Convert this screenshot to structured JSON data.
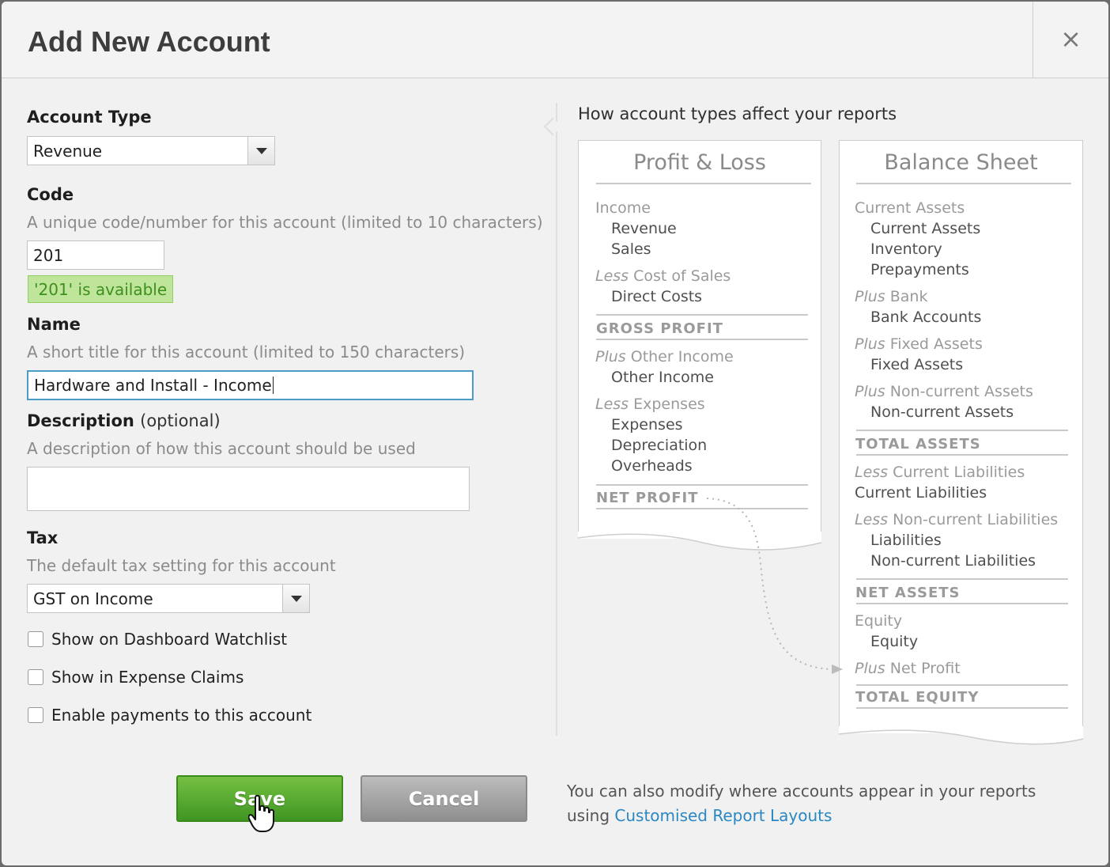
{
  "dialog": {
    "title": "Add New Account",
    "close_label": "×"
  },
  "form": {
    "account_type": {
      "label": "Account Type",
      "value": "Revenue"
    },
    "code": {
      "label": "Code",
      "hint": "A unique code/number for this account (limited to 10 characters)",
      "value": "201",
      "availability": "'201' is available"
    },
    "name": {
      "label": "Name",
      "hint": "A short title for this account (limited to 150 characters)",
      "value": "Hardware and Install - Income"
    },
    "description": {
      "label": "Description",
      "optional": "(optional)",
      "hint": "A description of how this account should be used",
      "value": ""
    },
    "tax": {
      "label": "Tax",
      "hint": "The default tax setting for this account",
      "value": "GST on Income"
    },
    "checkboxes": [
      {
        "label": "Show on Dashboard Watchlist",
        "checked": false
      },
      {
        "label": "Show in Expense Claims",
        "checked": false
      },
      {
        "label": "Enable payments to this account",
        "checked": false
      }
    ]
  },
  "reports": {
    "heading": "How account types affect your reports",
    "profit_loss": {
      "title": "Profit & Loss",
      "income": "Income",
      "revenue": "Revenue",
      "sales": "Sales",
      "less_cos_prefix": "Less",
      "less_cos": "Cost of Sales",
      "direct_costs": "Direct Costs",
      "gross_profit": "GROSS PROFIT",
      "plus_oi_prefix": "Plus",
      "plus_oi": "Other Income",
      "other_income": "Other Income",
      "less_exp_prefix": "Less",
      "less_exp": "Expenses",
      "expenses": "Expenses",
      "depreciation": "Depreciation",
      "overheads": "Overheads",
      "net_profit": "NET PROFIT"
    },
    "balance_sheet": {
      "title": "Balance Sheet",
      "current_assets_head": "Current Assets",
      "current_assets": "Current Assets",
      "inventory": "Inventory",
      "prepayments": "Prepayments",
      "plus_bank_prefix": "Plus",
      "plus_bank": "Bank",
      "bank_accounts": "Bank Accounts",
      "plus_fixed_prefix": "Plus",
      "plus_fixed": "Fixed Assets",
      "fixed_assets": "Fixed Assets",
      "plus_ncassets_prefix": "Plus",
      "plus_ncassets": "Non-current Assets",
      "ncassets": "Non-current Assets",
      "total_assets": "TOTAL ASSETS",
      "less_cl_prefix": "Less",
      "less_cl": "Current Liabilities",
      "current_liabilities": "Current Liabilities",
      "less_ncl_prefix": "Less",
      "less_ncl": "Non-current Liabilities",
      "liabilities": "Liabilities",
      "ncl": "Non-current Liabilities",
      "net_assets": "NET ASSETS",
      "equity_head": "Equity",
      "equity": "Equity",
      "plus_np_prefix": "Plus",
      "plus_np": "Net Profit",
      "total_equity": "TOTAL EQUITY"
    }
  },
  "buttons": {
    "save": "Save",
    "cancel": "Cancel"
  },
  "footer": {
    "note": "You can also modify where accounts appear in your reports",
    "using": "using",
    "link": "Customised Report Layouts"
  }
}
